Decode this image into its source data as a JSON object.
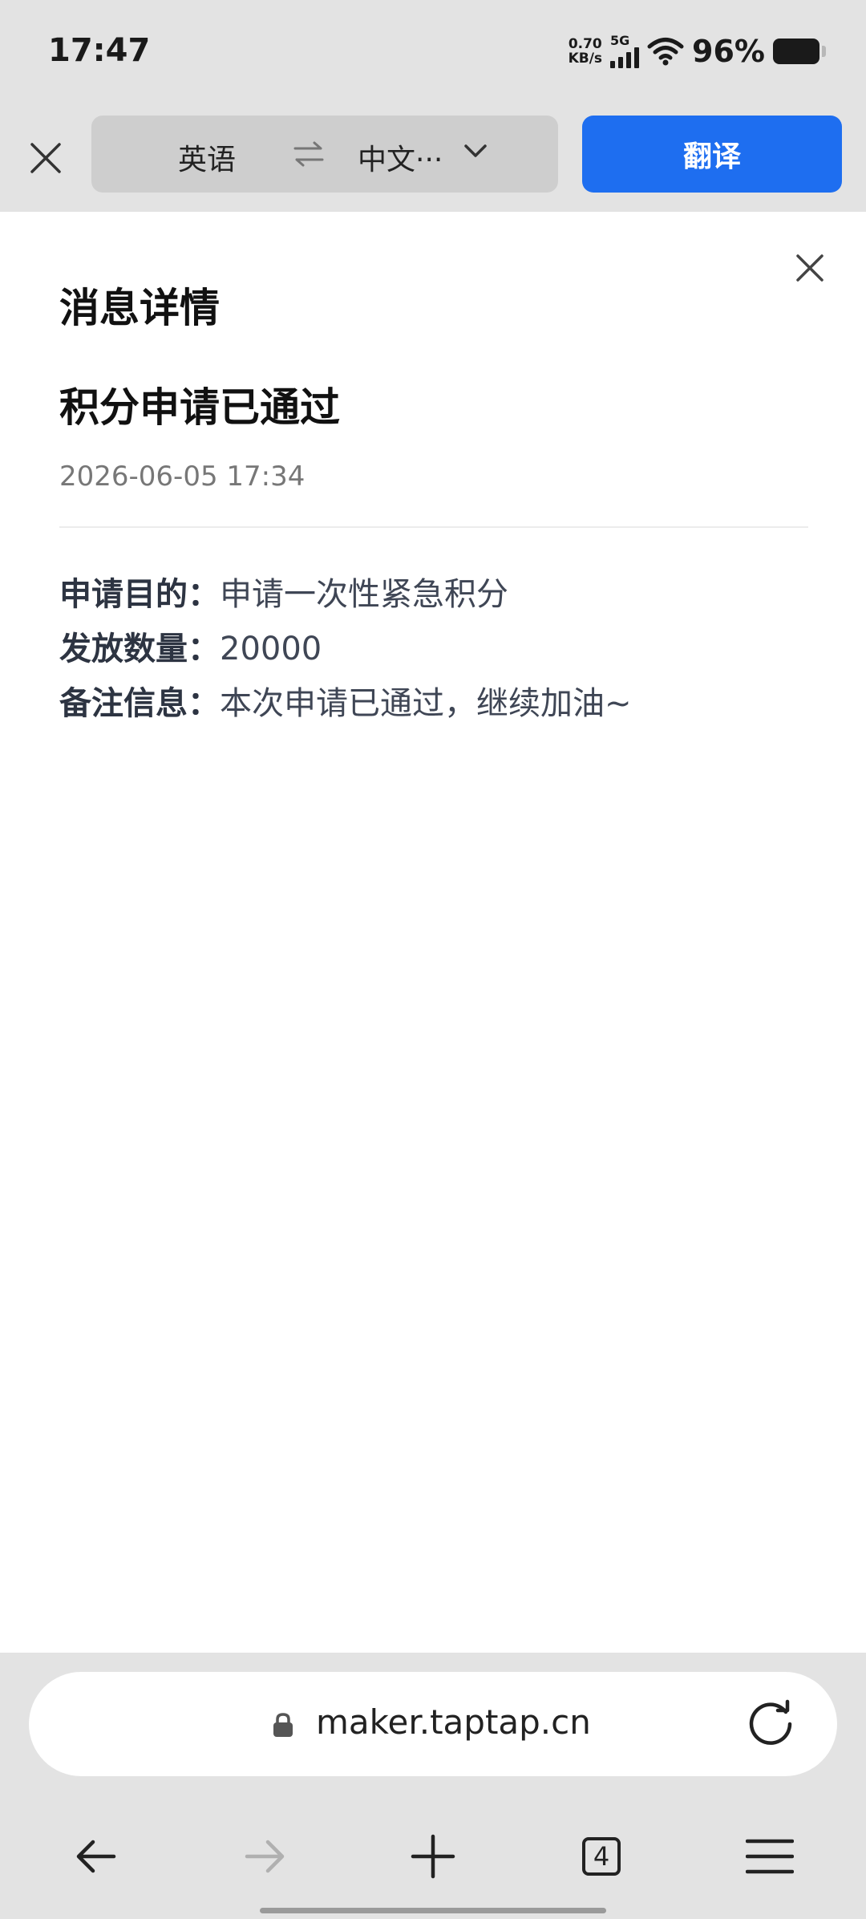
{
  "status_bar": {
    "time": "17:47",
    "net_speed_value": "0.70",
    "net_speed_unit": "KB/s",
    "network_type": "5G",
    "battery_percent": "96%"
  },
  "translate_bar": {
    "source_language": "英语",
    "target_language": "中文···",
    "translate_label": "翻译"
  },
  "message": {
    "page_title": "消息详情",
    "title": "积分申请已通过",
    "time": "2026-06-05 17:34",
    "details": [
      {
        "label": "申请目的",
        "value": "申请一次性紧急积分"
      },
      {
        "label": "发放数量",
        "value": "20000"
      },
      {
        "label": "备注信息",
        "value": "本次申请已通过，继续加油~"
      }
    ]
  },
  "url_bar": {
    "url": "maker.taptap.cn"
  },
  "bottom_nav": {
    "tab_count": "4"
  },
  "colors": {
    "accent": "#1e6ef0",
    "chrome_background": "#e3e3e3"
  }
}
